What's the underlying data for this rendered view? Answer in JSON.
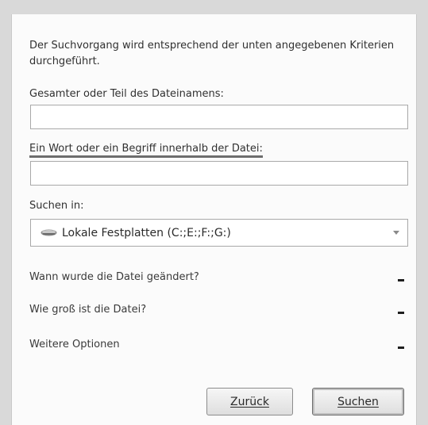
{
  "intro_text": "Der Suchvorgang wird entsprechend der unten angegebenen Kriterien durchgeführt.",
  "filename": {
    "label": "Gesamter oder Teil des Dateinamens:",
    "value": ""
  },
  "word": {
    "label": "Ein Wort oder ein Begriff innerhalb der Datei:",
    "value": ""
  },
  "search_in": {
    "label": "Suchen in:",
    "selected": "Lokale Festplatten (C:;E:;F:;G:)",
    "icon": "hard-drive-icon"
  },
  "sections": [
    {
      "label": "Wann wurde die Datei geändert?"
    },
    {
      "label": "Wie groß ist die Datei?"
    },
    {
      "label": "Weitere Optionen"
    }
  ],
  "buttons": {
    "back": "Zurück",
    "search": "Suchen"
  }
}
